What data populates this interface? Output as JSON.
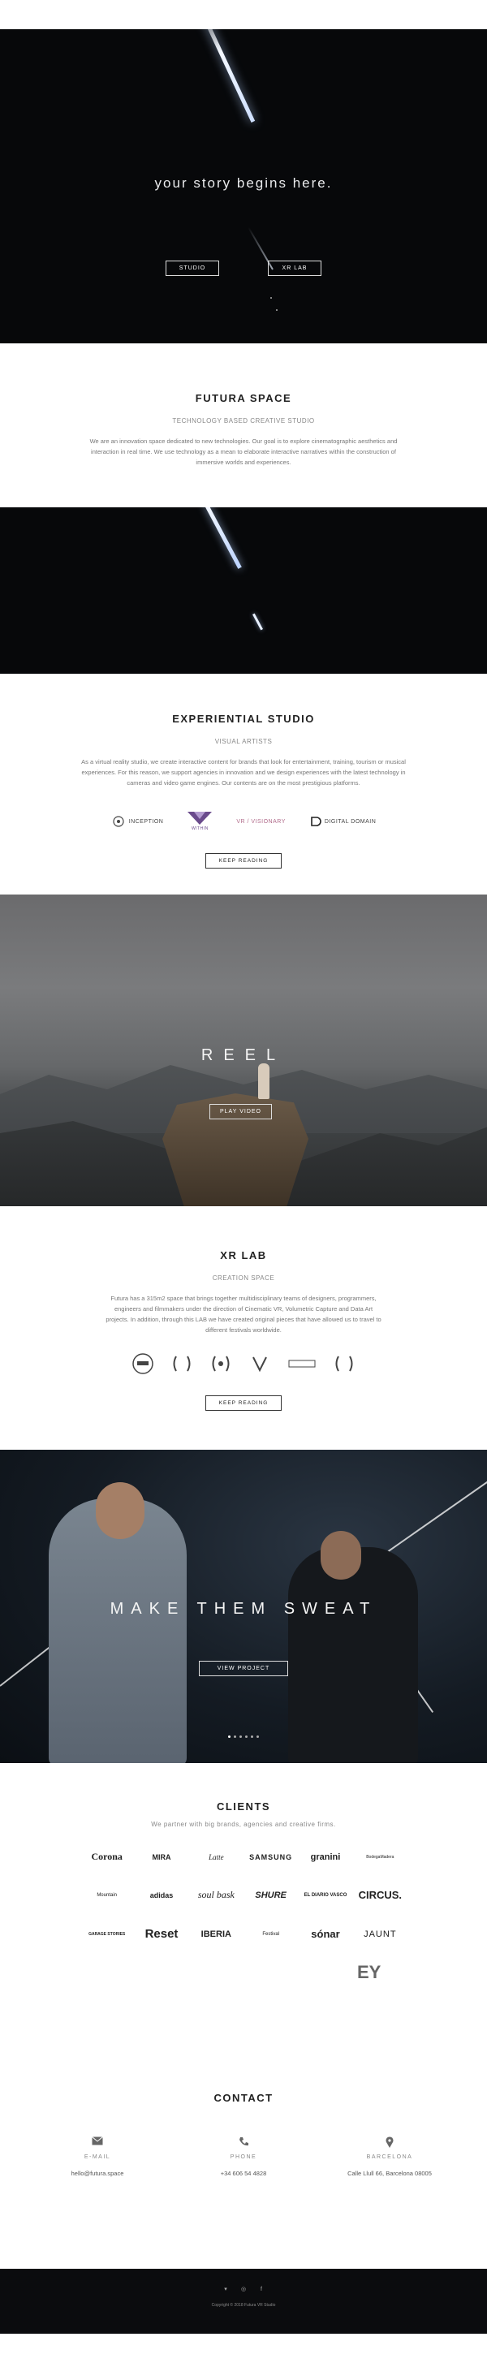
{
  "hero": {
    "title": "your story begins here.",
    "buttons": [
      "STUDIO",
      "XR LAB"
    ]
  },
  "futura": {
    "title": "FUTURA SPACE",
    "subtitle": "TECHNOLOGY BASED CREATIVE STUDIO",
    "text": "We are an innovation space dedicated to new technologies. Our goal is to explore cinematographic aesthetics and interaction in real time. We use technology as a mean to elaborate interactive narratives within the construction of immersive worlds and experiences."
  },
  "experiential": {
    "title": "EXPERIENTIAL STUDIO",
    "subtitle": "VISUAL ARTISTS",
    "text": "As a virtual reality studio, we create interactive content for brands that look for entertainment, training, tourism or musical experiences. For this reason, we support agencies in innovation and we design experiences with the latest technology in cameras and video game engines. Our contents are on the most prestigious platforms.",
    "logos": [
      "INCEPTION",
      "WITHIN",
      "VR / VISIONARY",
      "DIGITAL DOMAIN"
    ],
    "button": "KEEP READING"
  },
  "reel": {
    "title": "REEL",
    "button": "PLAY VIDEO"
  },
  "xrlab": {
    "title": "XR LAB",
    "subtitle": "CREATION SPACE",
    "text": "Futura has a 315m2 space that brings together multidisciplinary teams of designers, programmers, engineers and filmmakers under the direction of Cinematic VR, Volumetric Capture and Data Art projects. In addition, through this LAB we have created original pieces that have allowed us to travel to different festivals worldwide.",
    "button": "KEEP READING"
  },
  "sweat": {
    "title": "MAKE THEM SWEAT",
    "button": "VIEW PROJECT"
  },
  "clients": {
    "title": "CLIENTS",
    "subtitle": "We partner with big brands, agencies and creative firms.",
    "logos": [
      "Corona",
      "MIRA",
      "Latte",
      "SAMSUNG",
      "granini",
      "BodegaMadera",
      "Mountain",
      "adidas",
      "soul bask",
      "SHURE",
      "EL DIARIO VASCO",
      "CIRCUS.",
      "GARAGE STORIES",
      "Reset",
      "IBERIA",
      "Festival",
      "sónar",
      "JAUNT",
      "EY"
    ]
  },
  "contact": {
    "title": "CONTACT",
    "email_label": "E-MAIL",
    "email": "hello@futura.space",
    "phone_label": "PHONE",
    "phone": "+34 606 54 4828",
    "address_label": "BARCELONA",
    "address": "Calle Llull 66, Barcelona 08005"
  },
  "footer": {
    "copyright": "Copyright © 2018 Futura VR Studio"
  }
}
